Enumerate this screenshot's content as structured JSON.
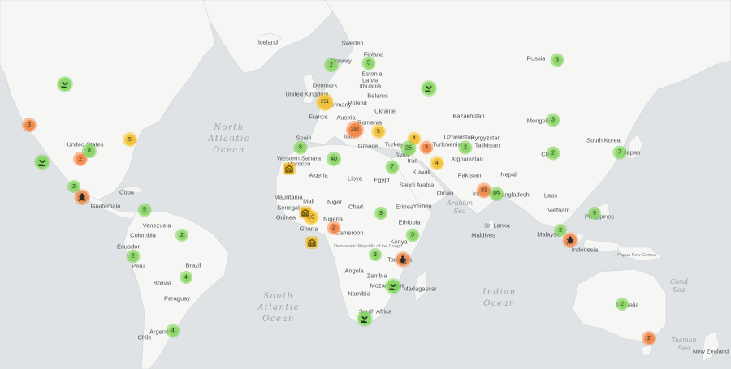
{
  "oceans": [
    {
      "id": "north-atlantic",
      "lines": [
        "North",
        "Atlantic",
        "Ocean"
      ]
    },
    {
      "id": "south-atlantic",
      "lines": [
        "South",
        "Atlantic",
        "Ocean"
      ]
    },
    {
      "id": "indian",
      "lines": [
        "Indian",
        "Ocean"
      ]
    },
    {
      "id": "arabian-sea",
      "lines": [
        "Arabian",
        "Sea"
      ]
    },
    {
      "id": "coral-sea",
      "lines": [
        "Coral",
        "Sea"
      ]
    },
    {
      "id": "tasman-sea",
      "lines": [
        "Tasman",
        "Sea"
      ]
    }
  ],
  "countries": [
    "Iceland",
    "Sweden",
    "Finland",
    "Norway",
    "Estonia",
    "Latvia",
    "Lithuania",
    "Denmark",
    "United Kingdom",
    "Belarus",
    "Poland",
    "Germany",
    "Ukraine",
    "France",
    "Austria",
    "Romania",
    "Spain",
    "Italy",
    "Greece",
    "Turkey",
    "Syria",
    "Iraq",
    "Kuwait",
    "Russia",
    "Kazakhstan",
    "Mongolia",
    "Uzbekistan",
    "Kyrgyzstan",
    "Turkmenistan",
    "Tajikistan",
    "Afghanistan",
    "Pakistan",
    "Nepal",
    "India",
    "Bangladesh",
    "Laos",
    "Vietnam",
    "Philippines",
    "Japan",
    "South Korea",
    "China",
    "Malaysia",
    "Indonesia",
    "Papua New Guinea",
    "Australia",
    "New Zealand",
    "United States",
    "Cuba",
    "Guatemala",
    "Venezuela",
    "Colombia",
    "Ecuador",
    "Peru",
    "Brazil",
    "Bolivia",
    "Paraguay",
    "Chile",
    "Argentina",
    "Morocco",
    "Algeria",
    "Libya",
    "Egypt",
    "Saudi Arabia",
    "Oman",
    "Yemen",
    "Eritrea",
    "Ethiopia",
    "Mauritania",
    "Mali",
    "Niger",
    "Chad",
    "Senegal",
    "Guinea",
    "Ghana",
    "Nigeria",
    "Cameroon",
    "Democratic Republic of the Congo",
    "Kenya",
    "Tanzania",
    "Angola",
    "Zambia",
    "Mozambique",
    "Madagascar",
    "Namibia",
    "South Africa",
    "Maldives",
    "Sri Lanka",
    "Western Sahara"
  ],
  "clusters": [
    {
      "label": "2",
      "color": "green"
    },
    {
      "label": "5",
      "color": "green"
    },
    {
      "label": "251",
      "color": "yellow"
    },
    {
      "label": "292",
      "color": "orange"
    },
    {
      "label": "5",
      "color": "yellow"
    },
    {
      "label": "3",
      "color": "green"
    },
    {
      "label": "3",
      "color": "green"
    },
    {
      "label": "2",
      "color": "green"
    },
    {
      "label": "7",
      "color": "green"
    },
    {
      "label": "3",
      "color": "orange"
    },
    {
      "label": "2",
      "color": "orange"
    },
    {
      "label": "8",
      "color": "green"
    },
    {
      "label": "5",
      "color": "yellow"
    },
    {
      "label": "2",
      "color": "green"
    },
    {
      "label": "5",
      "color": "green"
    },
    {
      "label": "8",
      "color": "green"
    },
    {
      "label": "40",
      "color": "green"
    },
    {
      "label": "4",
      "color": "yellow"
    },
    {
      "label": "25",
      "color": "green"
    },
    {
      "label": "3",
      "color": "orange"
    },
    {
      "label": "4",
      "color": "yellow"
    },
    {
      "label": "2",
      "color": "green"
    },
    {
      "label": "7",
      "color": "green"
    },
    {
      "label": "81",
      "color": "orange"
    },
    {
      "label": "89",
      "color": "green"
    },
    {
      "label": "3",
      "color": "green"
    },
    {
      "label": "10",
      "color": "yellow"
    },
    {
      "label": "2",
      "color": "orange"
    },
    {
      "label": "3",
      "color": "green"
    },
    {
      "label": "3",
      "color": "green"
    },
    {
      "label": "9",
      "color": "green"
    },
    {
      "label": "3",
      "color": "green"
    },
    {
      "label": "2",
      "color": "green"
    },
    {
      "label": "2",
      "color": "green"
    },
    {
      "label": "4",
      "color": "green"
    },
    {
      "label": "4",
      "color": "green"
    },
    {
      "label": "2",
      "color": "green"
    },
    {
      "label": "2",
      "color": "orange"
    }
  ],
  "icon_markers": [
    {
      "icon": "hand-seedling-icon",
      "color": "green"
    },
    {
      "icon": "hand-seedling-icon",
      "color": "green"
    },
    {
      "icon": "hand-seedling-icon",
      "color": "green"
    },
    {
      "icon": "hand-seedling-icon",
      "color": "green"
    },
    {
      "icon": "hand-seedling-icon",
      "color": "green"
    },
    {
      "icon": "bug-icon",
      "color": "orange"
    },
    {
      "icon": "bug-icon",
      "color": "orange"
    },
    {
      "icon": "bug-icon",
      "color": "orange"
    },
    {
      "icon": "warehouse-icon",
      "color": "yellow"
    },
    {
      "icon": "warehouse-icon",
      "color": "yellow"
    },
    {
      "icon": "warehouse-icon",
      "color": "yellow"
    }
  ],
  "colors": {
    "water": "#dfe3e6",
    "land": "#f6f6f4",
    "green": "#8fd66a",
    "yellow": "#f2c23c",
    "orange": "#f08a4e"
  }
}
